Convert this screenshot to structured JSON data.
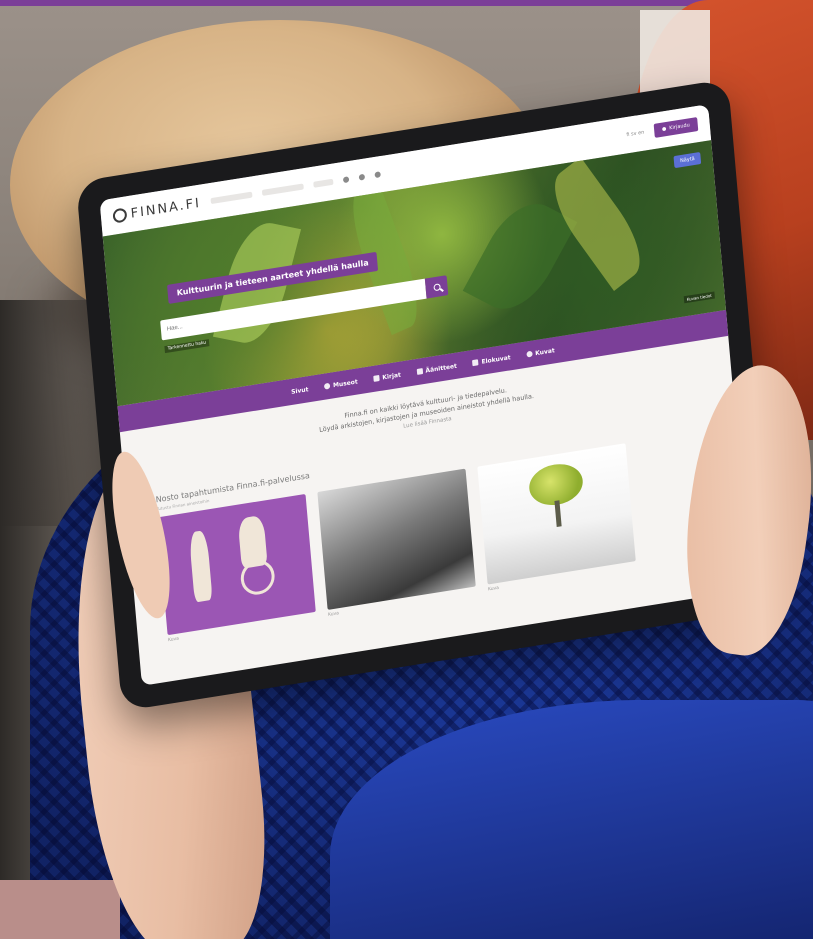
{
  "site": {
    "logo_text": "FINNA.FI",
    "login_label": "Kirjaudu",
    "language": "fi sv en",
    "hero_badge": "Näytä"
  },
  "hero": {
    "title": "Kulttuurin ja tieteen aarteet yhdellä haulla",
    "search_placeholder": "Hae...",
    "search_button_label": "Hae",
    "advanced_search": "Tarkennettu haku",
    "image_credit": "Kuvan tiedot"
  },
  "nav": {
    "items": [
      {
        "label": "Sivut",
        "icon": "page-icon"
      },
      {
        "label": "Museot",
        "icon": "museum-icon"
      },
      {
        "label": "Kirjat",
        "icon": "book-icon"
      },
      {
        "label": "Äänitteet",
        "icon": "audio-icon"
      },
      {
        "label": "Elokuvat",
        "icon": "film-icon"
      },
      {
        "label": "Kuvat",
        "icon": "image-icon"
      }
    ]
  },
  "intro": {
    "line1": "Finna.fi on kaikki löytävä kulttuuri- ja tiedepalvelu.",
    "line2": "Löydä arkistojen, kirjastojen ja museoiden aineistot yhdellä haulla.",
    "line3": "Lue lisää Finnasta"
  },
  "collections": {
    "title": "Nosto tapahtumista Finna.fi-palvelussa",
    "subtitle": "Tutustu Finnan aineistoihin",
    "cards": [
      {
        "caption": "Kuva",
        "style": "purple"
      },
      {
        "caption": "Kuva",
        "style": "gray"
      },
      {
        "caption": "Kuva",
        "style": "white"
      }
    ]
  },
  "colors": {
    "brand_purple": "#7b3f98",
    "top_band": "#7b3f98"
  }
}
